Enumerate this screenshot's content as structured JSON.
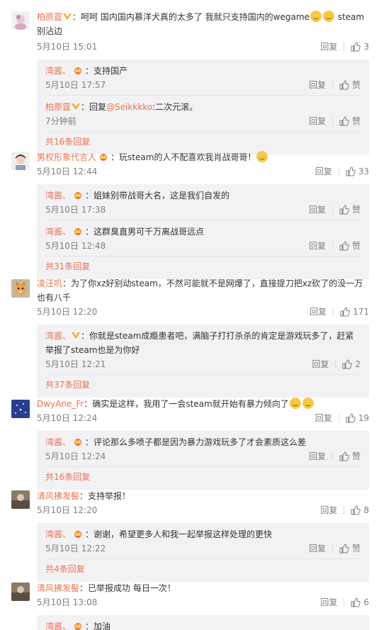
{
  "ui": {
    "reply_label": "回复",
    "like_label": "赞"
  },
  "colors": {
    "name": "#eb7350",
    "subbox_bg": "#f2f2f5",
    "meta": "#808080"
  },
  "comments": [
    {
      "author": "柏原霆",
      "text_a": "：呵呵  国内国内慕洋犬真的太多了 我就只支持国内的wegame",
      "text_b": " steam别沾边",
      "time": "5月10日 15:01",
      "likes": "3",
      "replies": [
        {
          "author": "湾酱、",
          "text": "：支持国产",
          "time": "5月10日 17:57"
        },
        {
          "author": "柏原霆",
          "text_pre": "：回复",
          "mention": "@Seikkkko",
          "text": ":二次元滚。",
          "time": "7分钟前"
        }
      ],
      "more": "共16条回复"
    },
    {
      "author": "男权形象代言人",
      "text_a": "：玩steam的人不配喜欢我肖战哥哥！",
      "time": "5月10日 12:44",
      "likes": "33",
      "replies": [
        {
          "author": "湾酱、",
          "text": "：姐妹别带战哥大名，这是我们自发的",
          "time": "5月10日 17:38"
        },
        {
          "author": "湾酱、",
          "text": "：这群臭直男可千万离战哥远点",
          "time": "5月10日 12:48"
        }
      ],
      "more": "共31条回复"
    },
    {
      "author": "凌汪叽",
      "text_a": "：为了你xz好别动steam，不然可能就不是网爆了，直接提刀把xz砍了的没一万也有八千",
      "time": "5月10日 12:20",
      "likes": "171",
      "replies": [
        {
          "author": "湾酱、",
          "text": "：你就是steam成瘾患者吧，满脑子打打杀杀的肯定是游戏玩多了，赶紧举报了steam也是为你好",
          "time": "5月10日 12:21",
          "likes": "2"
        }
      ],
      "more": "共37条回复"
    },
    {
      "author": "DwyAne_Fr",
      "text_a": "：确实是这样，我用了一会steam就开始有暴力倾向了",
      "time": "5月10日 12:24",
      "likes": "19",
      "replies": [
        {
          "author": "湾酱、",
          "text": "：评论那么多喷子都是因为暴力游戏玩多了才会素质这么差",
          "time": "5月10日 12:24"
        }
      ],
      "more": "共16条回复"
    },
    {
      "author": "清风拂发髻",
      "text_a": "：支持举报！",
      "time": "5月10日 12:20",
      "likes": "8",
      "replies": [
        {
          "author": "湾酱、",
          "text": "：谢谢，希望更多人和我一起举报这样处理的更快",
          "time": "5月10日 12:22"
        }
      ],
      "more": "共4条回复"
    },
    {
      "author": "清风拂发髻",
      "text_a": "：已举报成功 每日一次！",
      "time": "5月10日 13:08",
      "likes": "6",
      "replies": [
        {
          "author": "湾酱、",
          "text": "：加油"
        }
      ]
    }
  ]
}
